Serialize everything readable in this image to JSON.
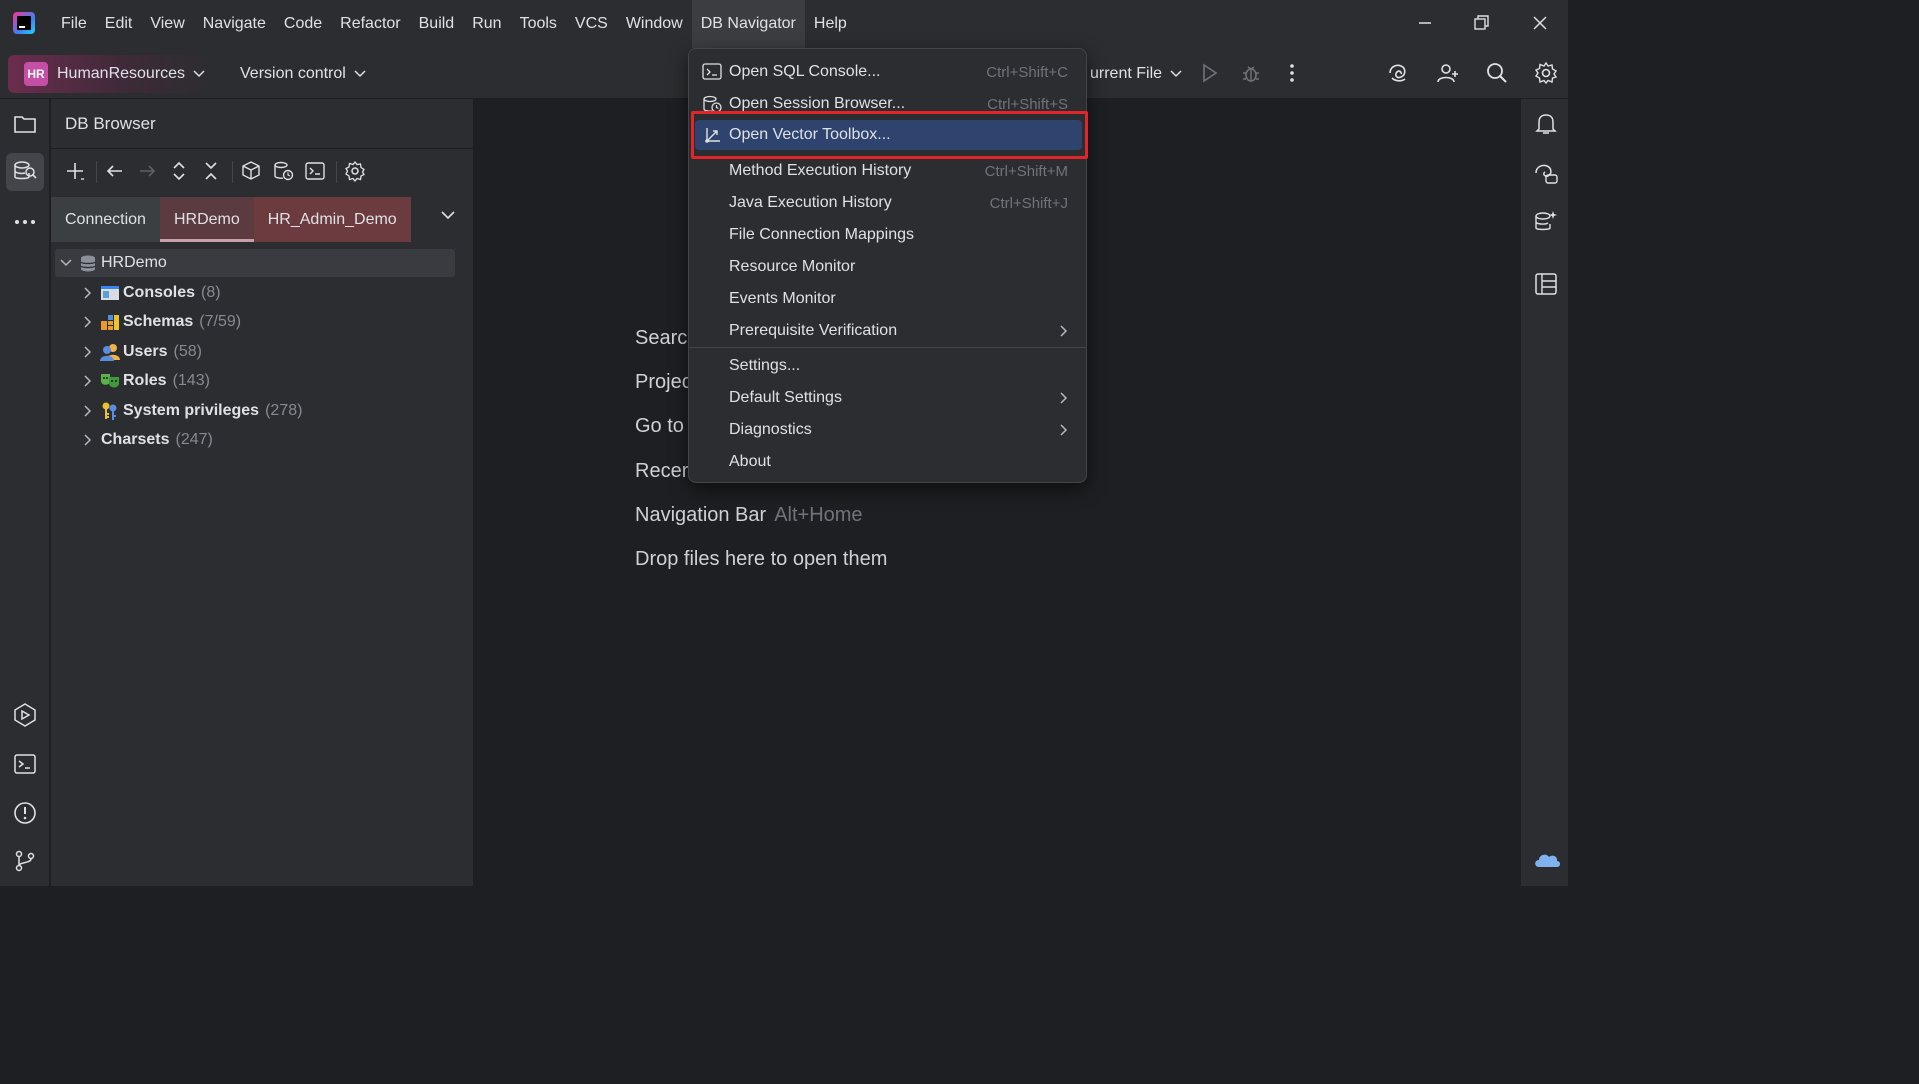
{
  "titlebar": {
    "menus": [
      "File",
      "Edit",
      "View",
      "Navigate",
      "Code",
      "Refactor",
      "Build",
      "Run",
      "Tools",
      "VCS",
      "Window",
      "DB Navigator",
      "Help"
    ],
    "active_menu": "DB Navigator"
  },
  "toolbar": {
    "project_badge": "HR",
    "project_name": "HumanResources",
    "vcs_label": "Version control",
    "run_config": "urrent File"
  },
  "db_browser": {
    "title": "DB Browser",
    "tabs": [
      "Connection",
      "HRDemo",
      "HR_Admin_Demo"
    ],
    "selected_tab": "HRDemo",
    "tree": {
      "root": "HRDemo",
      "children": [
        {
          "label": "Consoles",
          "count": "(8)"
        },
        {
          "label": "Schemas",
          "count": "(7/59)"
        },
        {
          "label": "Users",
          "count": "(58)"
        },
        {
          "label": "Roles",
          "count": "(143)"
        },
        {
          "label": "System privileges",
          "count": "(278)"
        },
        {
          "label": "Charsets",
          "count": "(247)"
        }
      ]
    }
  },
  "editor": {
    "hints": [
      {
        "label": "Searc",
        "key": ""
      },
      {
        "label": "Projec",
        "key": ""
      },
      {
        "label": "Go to",
        "key": ""
      },
      {
        "label": "Recer",
        "key": ""
      },
      {
        "label": "Navigation Bar",
        "key": "Alt+Home"
      },
      {
        "label": "Drop files here to open them",
        "key": ""
      }
    ]
  },
  "db_menu": {
    "items": [
      {
        "label": "Open SQL Console...",
        "shortcut": "Ctrl+Shift+C",
        "icon": "console-icon"
      },
      {
        "label": "Open Session Browser...",
        "shortcut": "Ctrl+Shift+S",
        "icon": "session-browser-icon"
      },
      {
        "label": "Open Vector Toolbox...",
        "shortcut": "",
        "icon": "vector-icon",
        "highlighted": true
      },
      {
        "label": "Method Execution History",
        "shortcut": "Ctrl+Shift+M"
      },
      {
        "label": "Java Execution History",
        "shortcut": "Ctrl+Shift+J"
      },
      {
        "label": "File Connection Mappings",
        "shortcut": ""
      },
      {
        "label": "Resource Monitor",
        "shortcut": ""
      },
      {
        "label": "Events Monitor",
        "shortcut": ""
      },
      {
        "label": "Prerequisite Verification",
        "shortcut": "",
        "submenu": true
      },
      {
        "label": "Settings...",
        "shortcut": ""
      },
      {
        "label": "Default Settings",
        "shortcut": "",
        "submenu": true
      },
      {
        "label": "Diagnostics",
        "shortcut": "",
        "submenu": true
      },
      {
        "label": "About",
        "shortcut": ""
      }
    ]
  },
  "colors": {
    "background": "#1e1f22",
    "panel": "#2b2d30",
    "menu_highlight": "#2e436e",
    "focus_outline": "#e0262b",
    "project_badge": "#c54fa7"
  }
}
